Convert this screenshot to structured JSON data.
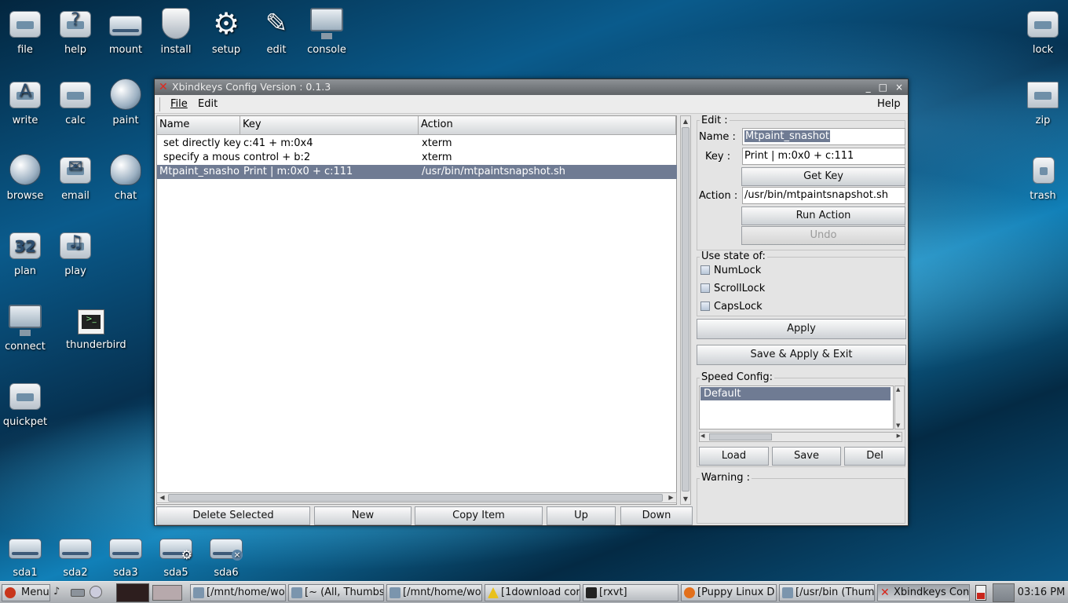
{
  "desktop": {
    "icons_top": [
      {
        "label": "file",
        "icon": "folder-icon"
      },
      {
        "label": "help",
        "icon": "help-icon"
      },
      {
        "label": "mount",
        "icon": "drive-icon"
      },
      {
        "label": "install",
        "icon": "install-icon"
      },
      {
        "label": "setup",
        "icon": "gear-icon"
      },
      {
        "label": "edit",
        "icon": "edit-icon"
      },
      {
        "label": "console",
        "icon": "console-icon"
      }
    ],
    "icons_left": [
      {
        "label": "write",
        "icon": "write-icon"
      },
      {
        "label": "calc",
        "icon": "calculator-icon"
      },
      {
        "label": "paint",
        "icon": "palette-icon"
      },
      {
        "label": "browse",
        "icon": "globe-icon"
      },
      {
        "label": "email",
        "icon": "envelope-icon"
      },
      {
        "label": "chat",
        "icon": "chat-icon"
      },
      {
        "label": "plan",
        "icon": "calendar-icon"
      },
      {
        "label": "play",
        "icon": "media-icon"
      },
      {
        "label": "connect",
        "icon": "network-icon"
      },
      {
        "label": "thunderbird",
        "icon": "terminal-icon"
      },
      {
        "label": "quickpet",
        "icon": "package-icon"
      }
    ],
    "icons_right": [
      {
        "label": "lock",
        "icon": "lock-icon"
      },
      {
        "label": "zip",
        "icon": "archive-icon"
      },
      {
        "label": "trash",
        "icon": "trash-icon"
      }
    ],
    "drives": [
      "sda1",
      "sda2",
      "sda3",
      "sda5",
      "sda6"
    ],
    "calendar_day": "32"
  },
  "window": {
    "title": "Xbindkeys Config Version : 0.1.3",
    "controls": {
      "minimize": "_",
      "maximize": "□",
      "close": "×"
    },
    "menu": {
      "file": "File",
      "edit": "Edit",
      "help": "Help"
    },
    "table": {
      "columns": [
        "Name",
        "Key",
        "Action"
      ],
      "rows": [
        {
          "name": "set directly key",
          "key": "c:41 + m:0x4",
          "action": "xterm",
          "selected": false
        },
        {
          "name": "specify a mous",
          "key": "control + b:2",
          "action": "xterm",
          "selected": false
        },
        {
          "name": "Mtpaint_snasho",
          "key": "Print | m:0x0 + c:111",
          "action": "/usr/bin/mtpaintsnapshot.sh",
          "selected": true
        }
      ]
    },
    "bottom_buttons": {
      "delete": "Delete Selected",
      "new": "New",
      "copy": "Copy Item",
      "up": "Up",
      "down": "Down"
    },
    "edit_panel": {
      "legend": "Edit :",
      "name_label": "Name :",
      "name_value": "Mtpaint_snashot",
      "key_label": "Key :",
      "key_value": "Print | m:0x0 + c:111",
      "get_key": "Get Key",
      "action_label": "Action :",
      "action_value": "/usr/bin/mtpaintsnapshot.sh",
      "run_action": "Run Action",
      "undo": "Undo"
    },
    "state_panel": {
      "legend": "Use state of:",
      "numlock": "NumLock",
      "scrolllock": "ScrollLock",
      "capslock": "CapsLock"
    },
    "apply": "Apply",
    "save_apply_exit": "Save & Apply & Exit",
    "speed": {
      "legend": "Speed Config:",
      "items": [
        "Default"
      ],
      "load": "Load",
      "save": "Save",
      "del": "Del"
    },
    "warning_legend": "Warning :"
  },
  "taskbar": {
    "menu": "Menu",
    "tasks": [
      "[/mnt/home/wo",
      "[~ (All, Thumbs",
      "[/mnt/home/wo",
      "[1download cor",
      "[rxvt]",
      "[Puppy Linux D",
      "[/usr/bin (Thum",
      "Xbindkeys Con"
    ],
    "clock": "03:16 PM"
  }
}
